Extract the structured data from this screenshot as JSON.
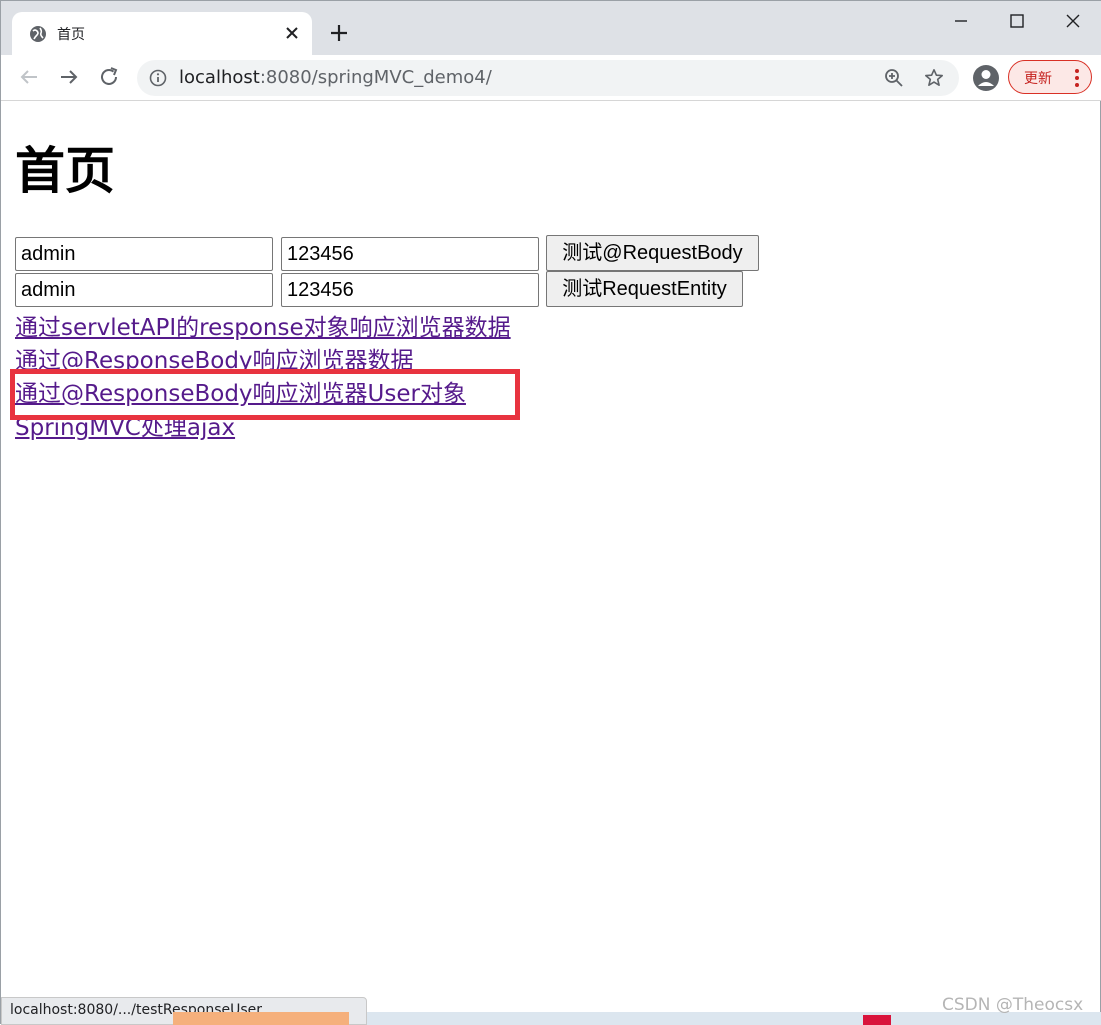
{
  "browser": {
    "tab_title": "首页",
    "url_host": "localhost",
    "url_rest": ":8080/springMVC_demo4/",
    "update_label": "更新"
  },
  "page": {
    "heading": "首页",
    "form1": {
      "username": "admin",
      "password": "123456",
      "submit_label": "测试@RequestBody"
    },
    "form2": {
      "username": "admin",
      "password": "123456",
      "submit_label": "测试RequestEntity"
    },
    "links": [
      "通过servletAPI的response对象响应浏览器数据",
      "通过@ResponseBody响应浏览器数据",
      "通过@ResponseBody响应浏览器User对象",
      "SpringMVC处理ajax"
    ]
  },
  "status_bar": {
    "text": "localhost:8080/.../testResponseUser"
  },
  "watermark": "CSDN @Theocsx",
  "colors": {
    "highlight": "#e8333f",
    "visited_link": "#551a8b",
    "update_accent": "#d93025"
  }
}
